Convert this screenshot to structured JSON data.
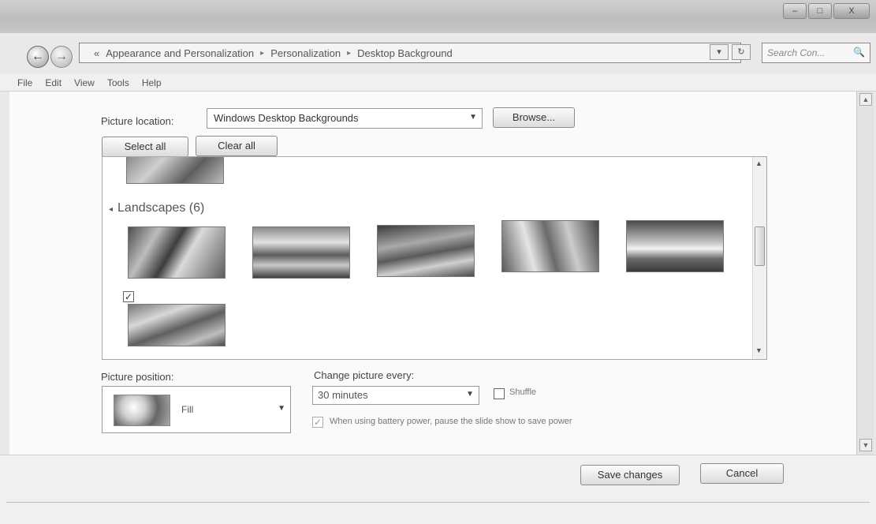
{
  "window": {
    "minimize": "–",
    "maximize": "□",
    "close": "X"
  },
  "nav": {
    "back": "←",
    "forward": "→"
  },
  "address": {
    "prefix": "«",
    "crumbs": [
      "Appearance and Personalization",
      "Personalization",
      "Desktop Background"
    ],
    "sep": "▸",
    "dropdown": "▾",
    "refresh": "↻"
  },
  "search": {
    "placeholder": "Search Con...",
    "icon": "🔍"
  },
  "menu": [
    "File",
    "Edit",
    "View",
    "Tools",
    "Help"
  ],
  "picture_location": {
    "label": "Picture location:",
    "value": "Windows Desktop Backgrounds",
    "browse": "Browse..."
  },
  "selection": {
    "select_all": "Select all",
    "clear_all": "Clear all"
  },
  "gallery": {
    "group_title": "Landscapes (6)",
    "group_toggle": "◂",
    "checked_mark": "✓"
  },
  "picture_position": {
    "label": "Picture position:",
    "value": "Fill"
  },
  "change_picture": {
    "label": "Change picture every:",
    "value": "30 minutes",
    "shuffle": "Shuffle",
    "battery": "When using battery power, pause the slide show to save power",
    "battery_checked": "✓"
  },
  "footer": {
    "save": "Save changes",
    "cancel": "Cancel"
  }
}
